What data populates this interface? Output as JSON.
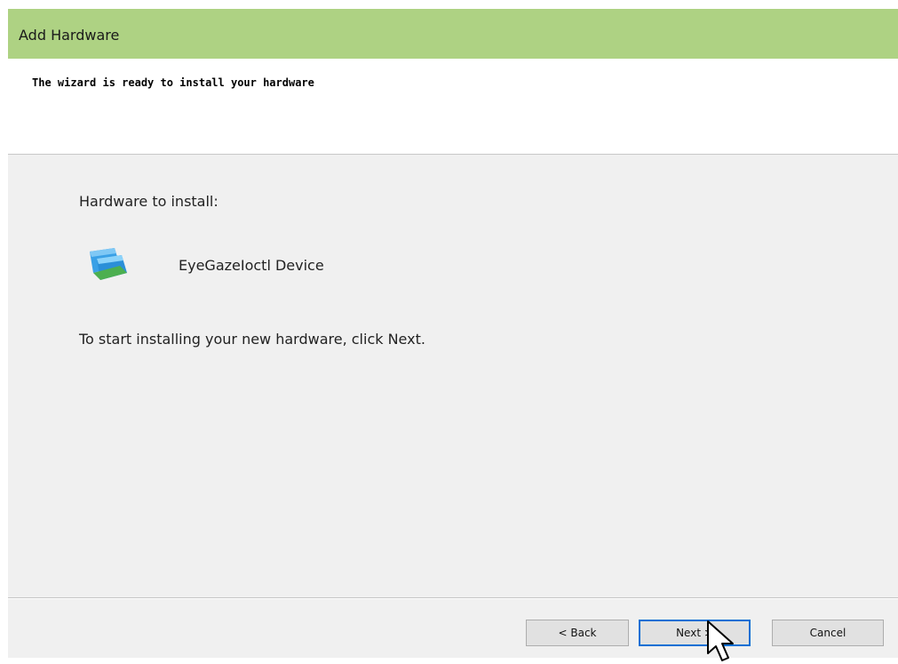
{
  "window": {
    "title": "Add Hardware"
  },
  "header": {
    "heading": "The wizard is ready to install your hardware"
  },
  "body": {
    "hardware_label": "Hardware to install:",
    "device_name": "EyeGazeIoctl Device",
    "instruction": "To start installing your new hardware, click Next."
  },
  "buttons": {
    "back": "< Back",
    "next": "Next >",
    "cancel": "Cancel"
  },
  "icons": {
    "device": "network-adapter-icon",
    "cursor": "mouse-pointer-icon"
  },
  "colors": {
    "titlebar": "#aed283",
    "focus_border": "#0a6fd4"
  }
}
